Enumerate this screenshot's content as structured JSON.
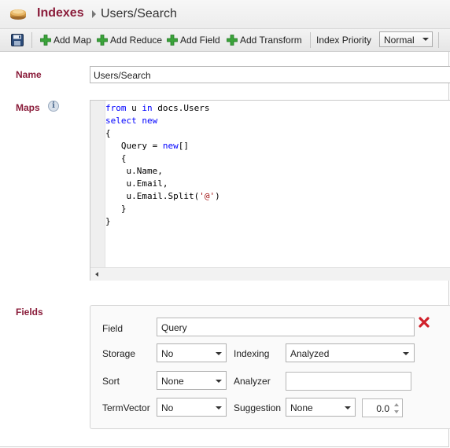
{
  "header": {
    "title": "Indexes",
    "crumb": "Users/Search"
  },
  "toolbar": {
    "add_map": "Add Map",
    "add_reduce": "Add Reduce",
    "add_field": "Add Field",
    "add_transform": "Add Transform",
    "priority_label": "Index Priority",
    "priority_value": "Normal"
  },
  "form": {
    "name_label": "Name",
    "name_value": "Users/Search",
    "maps_label": "Maps",
    "fields_label": "Fields"
  },
  "maps_code": {
    "l1a": "from",
    "l1b": " u ",
    "l1c": "in",
    "l1d": " docs.Users",
    "l2a": "select",
    "l2b": " ",
    "l2c": "new",
    "l3": "{",
    "l4a": "   Query = ",
    "l4b": "new",
    "l4c": "[]",
    "l5": "   {",
    "l6": "    u.Name,",
    "l7": "    u.Email,",
    "l8a": "    u.Email.Split(",
    "l8b": "'@'",
    "l8c": ")",
    "l9": "   }",
    "l10": "}"
  },
  "field": {
    "field_label": "Field",
    "field_value": "Query",
    "storage_label": "Storage",
    "storage_value": "No",
    "indexing_label": "Indexing",
    "indexing_value": "Analyzed",
    "sort_label": "Sort",
    "sort_value": "None",
    "analyzer_label": "Analyzer",
    "analyzer_value": "",
    "termvector_label": "TermVector",
    "termvector_value": "No",
    "suggestion_label": "Suggestion",
    "suggestion_value": "None",
    "accuracy_value": "0.0"
  },
  "colors": {
    "accent": "#8a1c3a",
    "keyword": "#0000ff",
    "string": "#a31515",
    "add_icon": "#3aa33a",
    "remove_icon": "#d0202a"
  },
  "icons": {
    "header": "indexes-stack-icon",
    "save": "save-disk-icon",
    "add": "plus-icon",
    "info": "info-icon",
    "remove": "close-icon"
  }
}
